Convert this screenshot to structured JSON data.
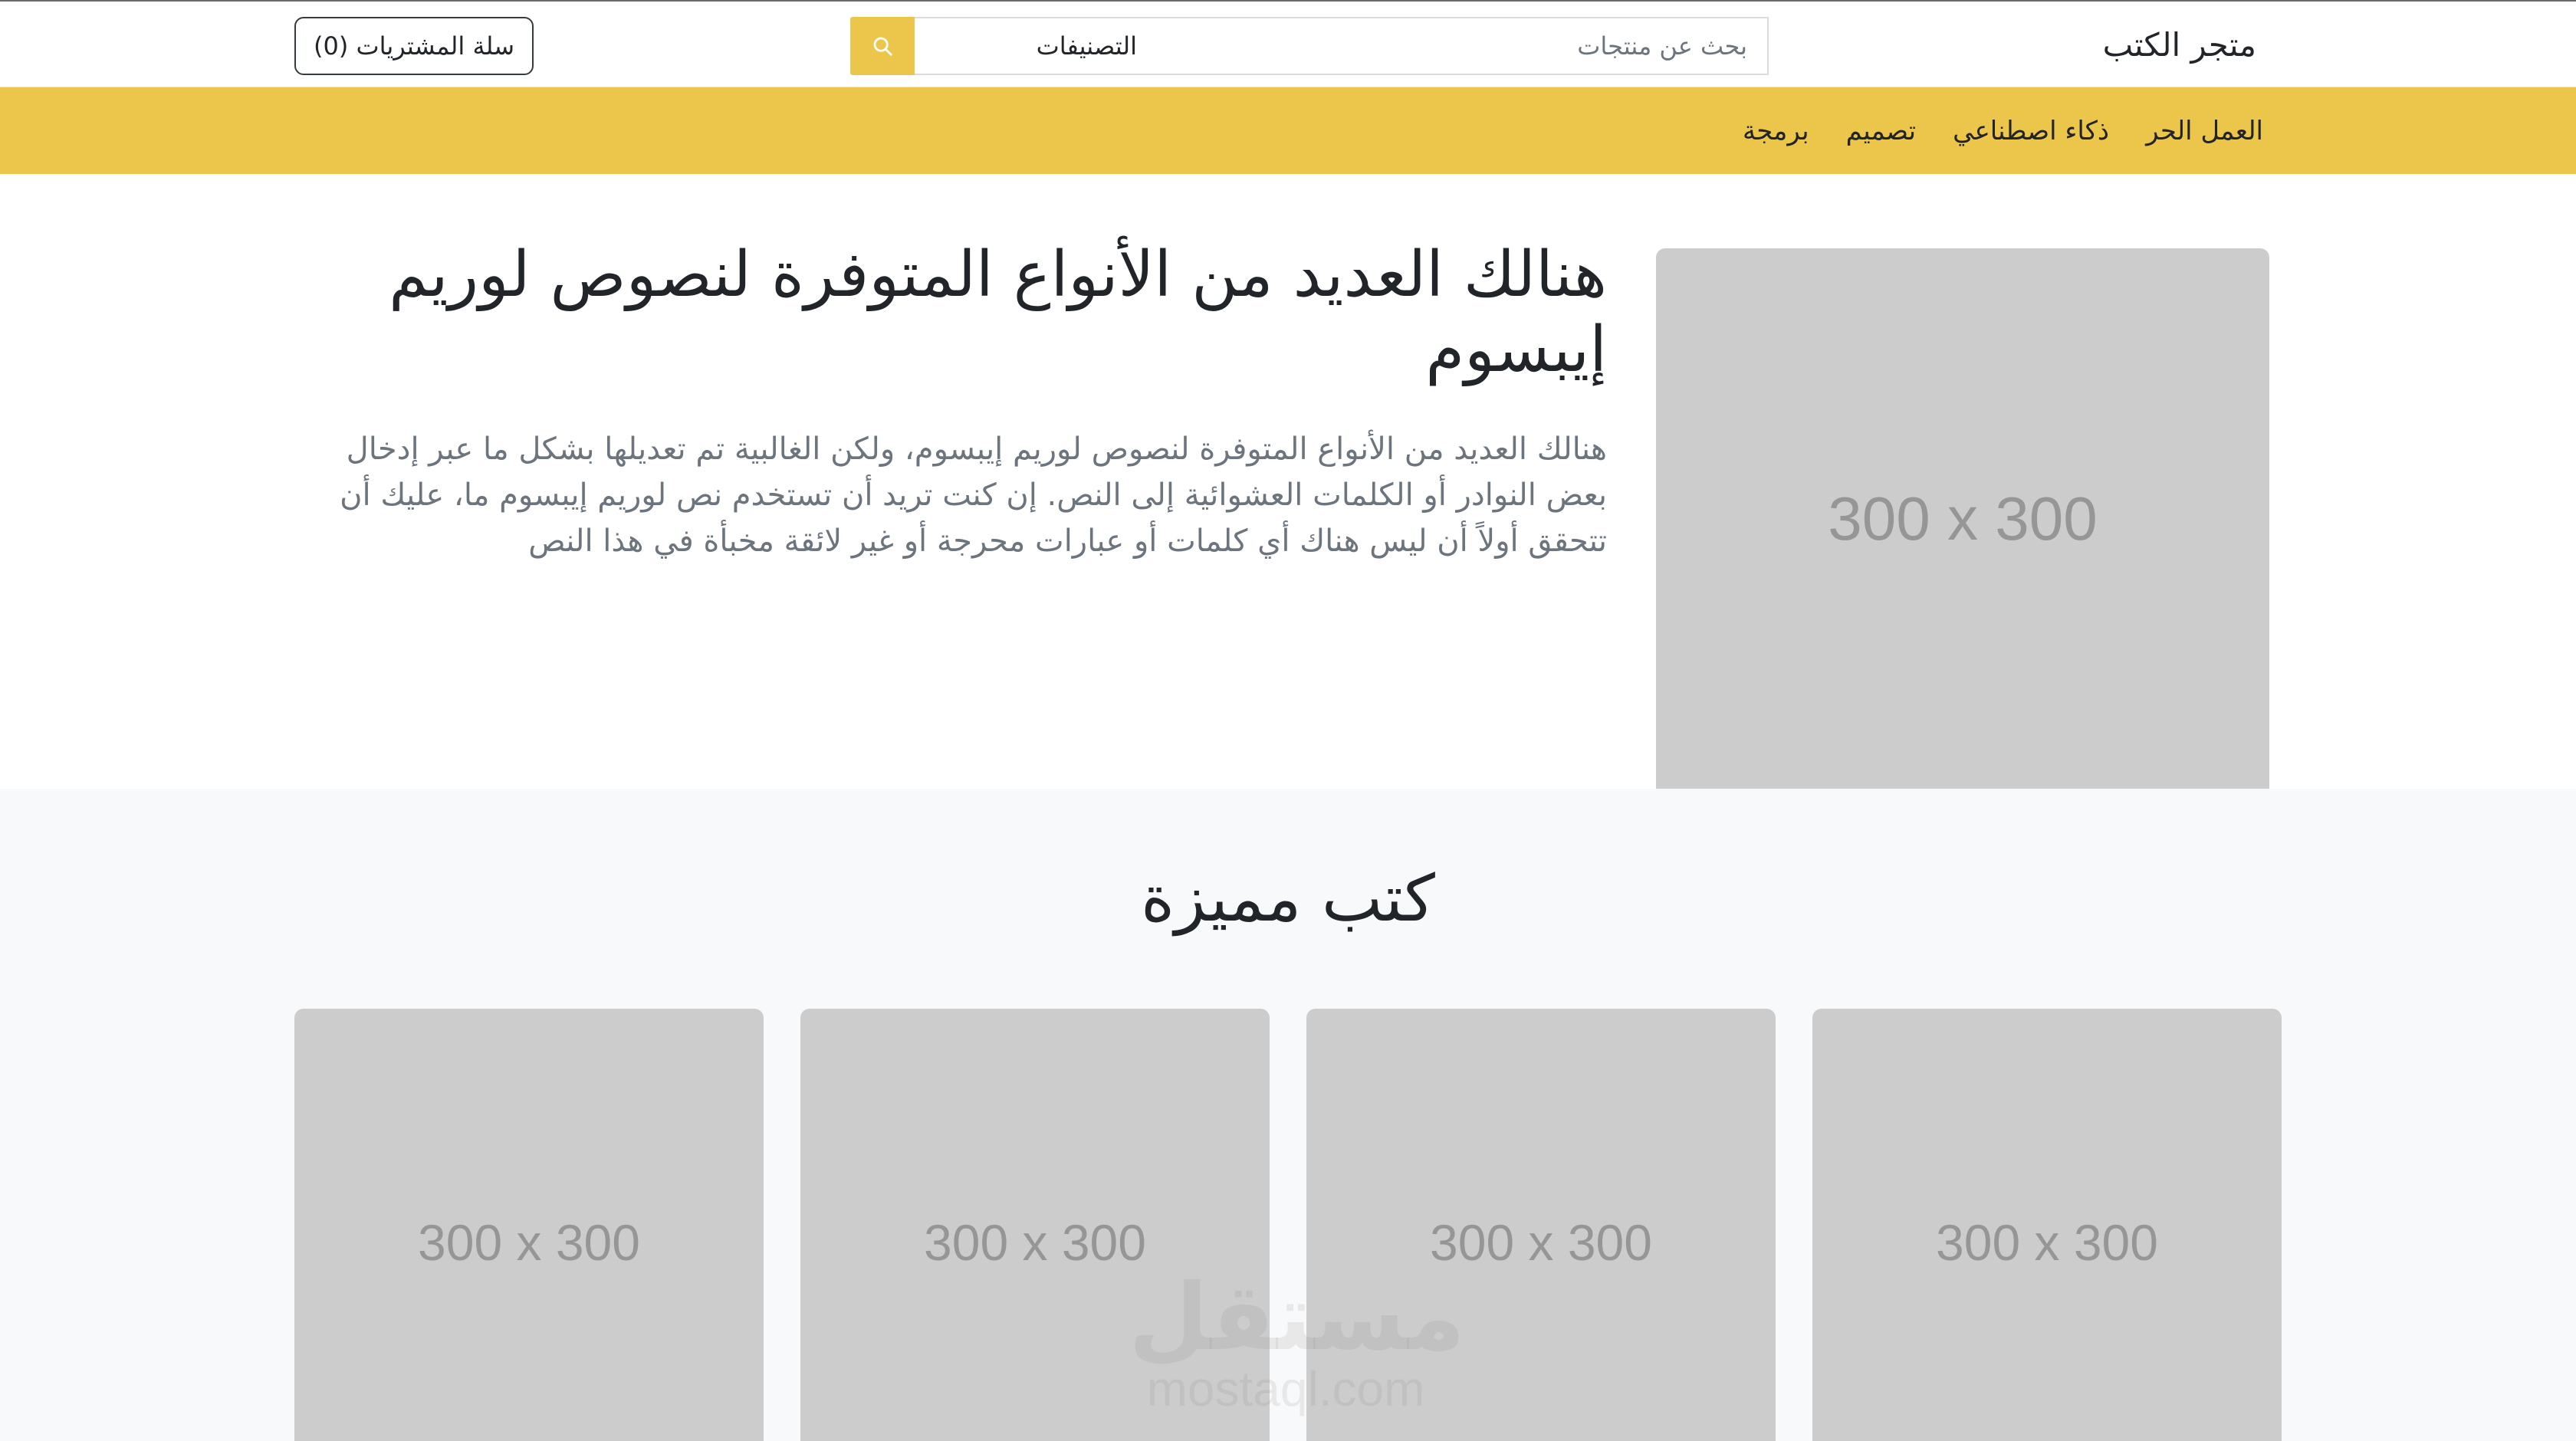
{
  "header": {
    "brand": "متجر الكتب",
    "search": {
      "placeholder": "بحث عن منتجات",
      "value": ""
    },
    "category": {
      "selected": "التصنيفات"
    },
    "cart_label": "سلة المشتريات (0)",
    "search_icon": "search-icon"
  },
  "nav": {
    "items": [
      {
        "label": "برمجة"
      },
      {
        "label": "تصميم"
      },
      {
        "label": "ذكاء اصطناعي"
      },
      {
        "label": "العمل الحر"
      }
    ]
  },
  "hero": {
    "title": "هنالك العديد من الأنواع المتوفرة لنصوص لوريم إيبسوم",
    "text": "هنالك العديد من الأنواع المتوفرة لنصوص لوريم إيبسوم، ولكن الغالبية تم تعديلها بشكل ما عبر إدخال بعض النوادر أو الكلمات العشوائية إلى النص. إن كنت تريد أن تستخدم نص لوريم إيبسوم ما، عليك أن تتحقق أولاً أن ليس هناك أي كلمات أو عبارات محرجة أو غير لائقة مخبأة في هذا النص",
    "image_label": "300 x 300"
  },
  "featured": {
    "title": "كتب مميزة",
    "books": [
      {
        "image_label": "300 x 300"
      },
      {
        "image_label": "300 x 300"
      },
      {
        "image_label": "300 x 300"
      },
      {
        "image_label": "300 x 300"
      }
    ]
  },
  "watermark": {
    "arabic": "مستقل",
    "latin": "mostaql.com"
  },
  "colors": {
    "accent": "#ecc54b",
    "placeholder_bg": "#cccccc",
    "section_bg": "#f8f9fa",
    "muted_text": "#6c757d"
  }
}
